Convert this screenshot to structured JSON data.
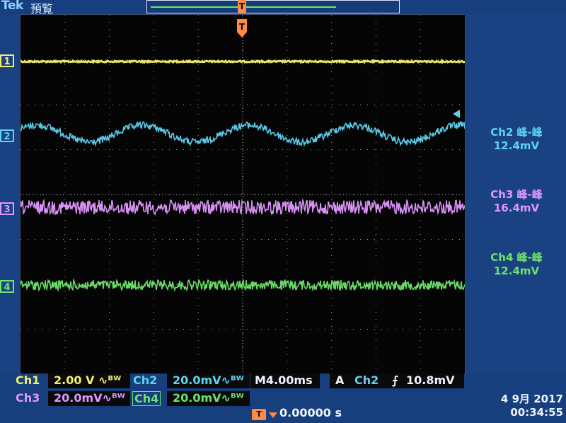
{
  "app": {
    "brand": "Tek",
    "status": "預覧"
  },
  "channels": [
    {
      "id": "ch1",
      "marker": "1",
      "color": "#f4ef72"
    },
    {
      "id": "ch2",
      "marker": "2",
      "color": "#5fd2f2"
    },
    {
      "id": "ch3",
      "marker": "3",
      "color": "#e098ff"
    },
    {
      "id": "ch4",
      "marker": "4",
      "color": "#6ee46a"
    }
  ],
  "measurements": [
    {
      "label": "Ch2 峰-峰",
      "value": "12.4mV",
      "color": "#5fd2f2"
    },
    {
      "label": "Ch3 峰-峰",
      "value": "16.4mV",
      "color": "#e098ff"
    },
    {
      "label": "Ch4 峰-峰",
      "value": "12.4mV",
      "color": "#6ee46a"
    }
  ],
  "scale": {
    "ch1": {
      "label": "Ch1",
      "value": "2.00 V",
      "bw": "∿ᴮᵂ"
    },
    "ch2": {
      "label": "Ch2",
      "value": "20.0mV",
      "bw": "∿ᴮᵂ"
    },
    "ch3": {
      "label": "Ch3",
      "value": "20.0mV",
      "bw": "∿ᴮᵂ"
    },
    "ch4": {
      "label": "Ch4",
      "value": "20.0mV",
      "bw": "∿ᴮᵂ"
    }
  },
  "timebase": {
    "label": "M",
    "value": "4.00ms"
  },
  "trigger": {
    "mode": "A",
    "source": "Ch2",
    "edge_icon": "rising-edge-icon",
    "edge_glyph": "⨍",
    "level": "10.8mV",
    "marker": "T"
  },
  "position": {
    "badge": "T",
    "value": "0.00000 s"
  },
  "clock": {
    "date": "4 9月 2017",
    "time": "00:34:55"
  },
  "waveforms": {
    "ch1": {
      "shape": "flat",
      "noise": 1
    },
    "ch2": {
      "shape": "sine",
      "cycles": 4.2,
      "amp": 12,
      "noise": 5
    },
    "ch3": {
      "shape": "noise",
      "noise": 10
    },
    "ch4": {
      "shape": "noise",
      "noise": 7
    }
  }
}
